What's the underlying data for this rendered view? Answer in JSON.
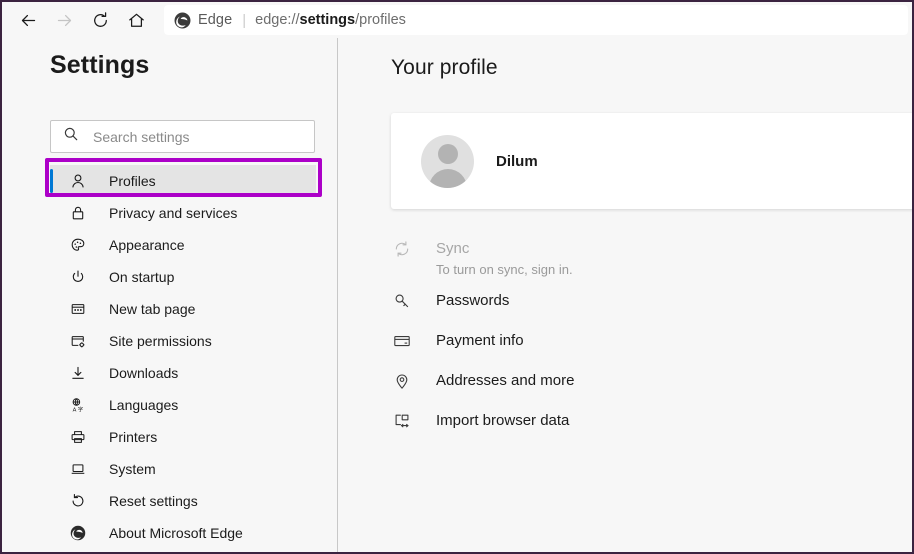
{
  "toolbar": {
    "back_label": "Back",
    "forward_label": "Forward",
    "refresh_label": "Refresh",
    "home_label": "Home",
    "brand": "Edge",
    "separator": "|",
    "url_prefix": "edge://",
    "url_bold": "settings",
    "url_suffix": "/profiles"
  },
  "sidebar": {
    "title": "Settings",
    "search": {
      "placeholder": "Search settings",
      "value": ""
    },
    "items": [
      {
        "label": "Profiles",
        "icon": "person-icon",
        "selected": true
      },
      {
        "label": "Privacy and services",
        "icon": "lock-icon",
        "selected": false
      },
      {
        "label": "Appearance",
        "icon": "palette-icon",
        "selected": false
      },
      {
        "label": "On startup",
        "icon": "power-icon",
        "selected": false
      },
      {
        "label": "New tab page",
        "icon": "new-tab-icon",
        "selected": false
      },
      {
        "label": "Site permissions",
        "icon": "site-permissions-icon",
        "selected": false
      },
      {
        "label": "Downloads",
        "icon": "download-icon",
        "selected": false
      },
      {
        "label": "Languages",
        "icon": "languages-icon",
        "selected": false
      },
      {
        "label": "Printers",
        "icon": "printer-icon",
        "selected": false
      },
      {
        "label": "System",
        "icon": "laptop-icon",
        "selected": false
      },
      {
        "label": "Reset settings",
        "icon": "reset-icon",
        "selected": false
      },
      {
        "label": "About Microsoft Edge",
        "icon": "edge-logo-icon",
        "selected": false
      }
    ]
  },
  "main": {
    "title": "Your profile",
    "profile_card": {
      "name": "Dilum",
      "avatar": "default-avatar-icon"
    },
    "items": [
      {
        "label": "Sync",
        "sub": "To turn on sync, sign in.",
        "icon": "sync-icon",
        "disabled": true
      },
      {
        "label": "Passwords",
        "sub": "",
        "icon": "key-icon",
        "disabled": false
      },
      {
        "label": "Payment info",
        "sub": "",
        "icon": "credit-card-icon",
        "disabled": false
      },
      {
        "label": "Addresses and more",
        "sub": "",
        "icon": "location-pin-icon",
        "disabled": false
      },
      {
        "label": "Import browser data",
        "sub": "",
        "icon": "import-icon",
        "disabled": false
      }
    ]
  },
  "annotation": {
    "target": "Profiles",
    "color": "#ac00c8"
  },
  "colors": {
    "accent_blue": "#0078d4",
    "annotation_purple": "#ac00c8",
    "page_background": "#f7f7f7",
    "card_background": "#ffffff",
    "frame_border": "#3b2340"
  }
}
